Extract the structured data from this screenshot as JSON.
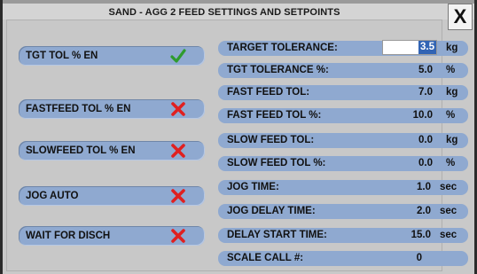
{
  "window": {
    "title": "SAND - AGG 2 FEED  SETTINGS AND SETPOINTS",
    "close_label": "X"
  },
  "toggles": [
    {
      "label": "TGT TOL % EN",
      "state": "enabled",
      "icon": "check-icon"
    },
    {
      "label": "FASTFEED TOL % EN",
      "state": "disabled",
      "icon": "x-icon"
    },
    {
      "label": "SLOWFEED TOL % EN",
      "state": "disabled",
      "icon": "x-icon"
    },
    {
      "label": "JOG AUTO",
      "state": "disabled",
      "icon": "x-icon"
    },
    {
      "label": "WAIT FOR DISCH",
      "state": "disabled",
      "icon": "x-icon"
    }
  ],
  "settings": [
    {
      "label": "TARGET TOLERANCE:",
      "value": "3.5",
      "unit": "kg"
    },
    {
      "label": "TGT TOLERANCE %:",
      "value": "5.0",
      "unit": "%"
    },
    {
      "label": "FAST FEED TOL:",
      "value": "7.0",
      "unit": "kg"
    },
    {
      "label": "FAST FEED TOL %:",
      "value": "10.0",
      "unit": "%"
    },
    {
      "label": "SLOW FEED TOL:",
      "value": "0.0",
      "unit": "kg"
    },
    {
      "label": "SLOW FEED TOL %:",
      "value": "0.0",
      "unit": "%"
    },
    {
      "label": "JOG TIME:",
      "value": "1.0",
      "unit": "sec"
    },
    {
      "label": "JOG DELAY TIME:",
      "value": "2.0",
      "unit": "sec"
    },
    {
      "label": "DELAY START TIME:",
      "value": "15.0",
      "unit": "sec"
    },
    {
      "label": "SCALE CALL #:",
      "value": "0",
      "unit": ""
    }
  ],
  "colors": {
    "button_blue": "#8fa9d0",
    "check_green": "#2e9b2e",
    "x_red": "#e02020",
    "selection": "#3264b4"
  }
}
